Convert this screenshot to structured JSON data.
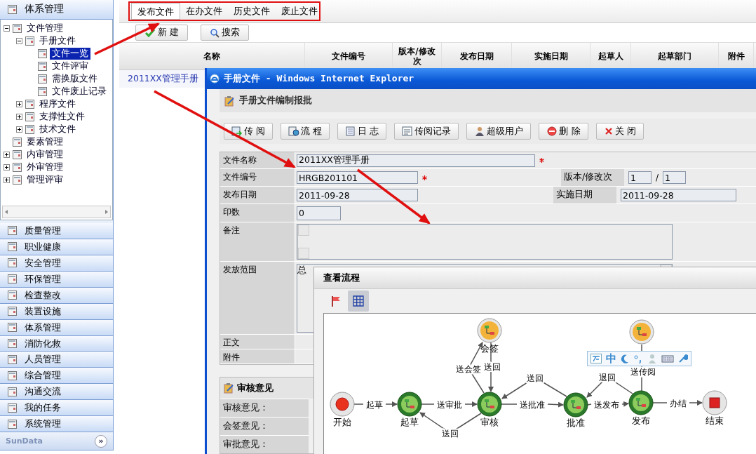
{
  "sidebar": {
    "header": "体系管理",
    "tree": [
      {
        "label": "文件管理",
        "expanded": true,
        "selected": false,
        "children": [
          {
            "label": "手册文件",
            "expanded": true,
            "selected": false,
            "children": [
              {
                "label": "文件一览",
                "selected": true
              },
              {
                "label": "文件评审",
                "selected": false
              },
              {
                "label": "需换版文件",
                "selected": false
              },
              {
                "label": "文件废止记录",
                "selected": false
              }
            ]
          },
          {
            "label": "程序文件",
            "expanded": false,
            "selected": false
          },
          {
            "label": "支撑性文件",
            "expanded": false,
            "selected": false
          },
          {
            "label": "技术文件",
            "expanded": false,
            "selected": false
          }
        ]
      },
      {
        "label": "要素管理",
        "selected": false
      },
      {
        "label": "内审管理",
        "expanded": false,
        "selected": false
      },
      {
        "label": "外审管理",
        "expanded": false,
        "selected": false
      },
      {
        "label": "管理评审",
        "expanded": false,
        "selected": false
      }
    ],
    "modules": [
      "质量管理",
      "职业健康",
      "安全管理",
      "环保管理",
      "检查整改",
      "装置设施",
      "体系管理",
      "消防化救",
      "人员管理",
      "综合管理",
      "沟通交流",
      "我的任务",
      "系统管理"
    ],
    "footer": {
      "logo": "SunData",
      "expand": "»"
    }
  },
  "main": {
    "tabs": [
      {
        "label": "发布文件",
        "selected": true
      },
      {
        "label": "在办文件",
        "selected": false
      },
      {
        "label": "历史文件",
        "selected": false
      },
      {
        "label": "废止文件",
        "selected": false
      }
    ],
    "toolbar": [
      {
        "label": "新 建",
        "kind": "check"
      },
      {
        "label": "搜索",
        "kind": "search"
      }
    ],
    "table": {
      "columns": [
        "名称",
        "文件编号",
        "版本/修改次",
        "发布日期",
        "实施日期",
        "起草人",
        "起草部门",
        "附件"
      ],
      "rows": [
        {
          "cells": [
            "2011XX管理手册"
          ]
        }
      ]
    }
  },
  "dialog": {
    "title": "手册文件 - Windows Internet Explorer",
    "heading": "手册文件编制报批",
    "buttons": [
      {
        "label": "传 阅",
        "kind": "send"
      },
      {
        "label": "流 程",
        "kind": "flow"
      },
      {
        "label": "日 志",
        "kind": "log"
      },
      {
        "label": "传阅记录",
        "kind": "list"
      },
      {
        "label": "超级用户",
        "kind": "user"
      },
      {
        "label": "删 除",
        "kind": "delete"
      },
      {
        "label": "关 闭",
        "kind": "close"
      }
    ],
    "form": [
      {
        "kind": "wide",
        "label": "文件名称",
        "value": "2011XX管理手册",
        "required": true
      },
      {
        "kind": "split",
        "label": "文件编号",
        "value": "HRGB201101",
        "required": true,
        "right_label": "版本/修改次",
        "right_values": [
          "1",
          "1"
        ],
        "separator": "/"
      },
      {
        "kind": "split",
        "label": "发布日期",
        "value": "2011-09-28",
        "required": false,
        "right_label": "实施日期",
        "right_values": [
          "2011-09-28"
        ]
      },
      {
        "kind": "short",
        "label": "印数",
        "value": "0",
        "required": false
      },
      {
        "kind": "area",
        "label": "备注"
      },
      {
        "kind": "area",
        "label": "发放范围",
        "value": "总"
      },
      {
        "kind": "blank",
        "label": "正文"
      },
      {
        "kind": "blank",
        "label": "附件"
      }
    ],
    "review": {
      "heading": "审核意见",
      "labels": [
        "审核意见：",
        "会签意见：",
        "审批意见："
      ]
    }
  },
  "flow_window": {
    "title": "查看流程",
    "toolbar": [
      {
        "kind": "flag",
        "selected": false
      },
      {
        "kind": "grid",
        "selected": true
      }
    ],
    "nodes": [
      {
        "kind": "side",
        "label": "会签"
      },
      {
        "kind": "side"
      },
      {
        "kind": "start",
        "label": "开始"
      },
      {
        "kind": "task",
        "label": "起草"
      },
      {
        "kind": "task",
        "label": "审核"
      },
      {
        "kind": "task",
        "label": "批准"
      },
      {
        "kind": "task",
        "label": "发布"
      },
      {
        "kind": "end",
        "label": "结束"
      }
    ],
    "edges": [
      {
        "label": "起草"
      },
      {
        "label": "送审批"
      },
      {
        "label": "送回"
      },
      {
        "label": "送会签"
      },
      {
        "label": "送回"
      },
      {
        "label": "送回"
      },
      {
        "label": "送批准"
      },
      {
        "label": "退回"
      },
      {
        "label": "送发布"
      },
      {
        "label": "送传阅"
      },
      {
        "label": "办结"
      }
    ],
    "ime_toolbar": {
      "mode": "中"
    }
  }
}
